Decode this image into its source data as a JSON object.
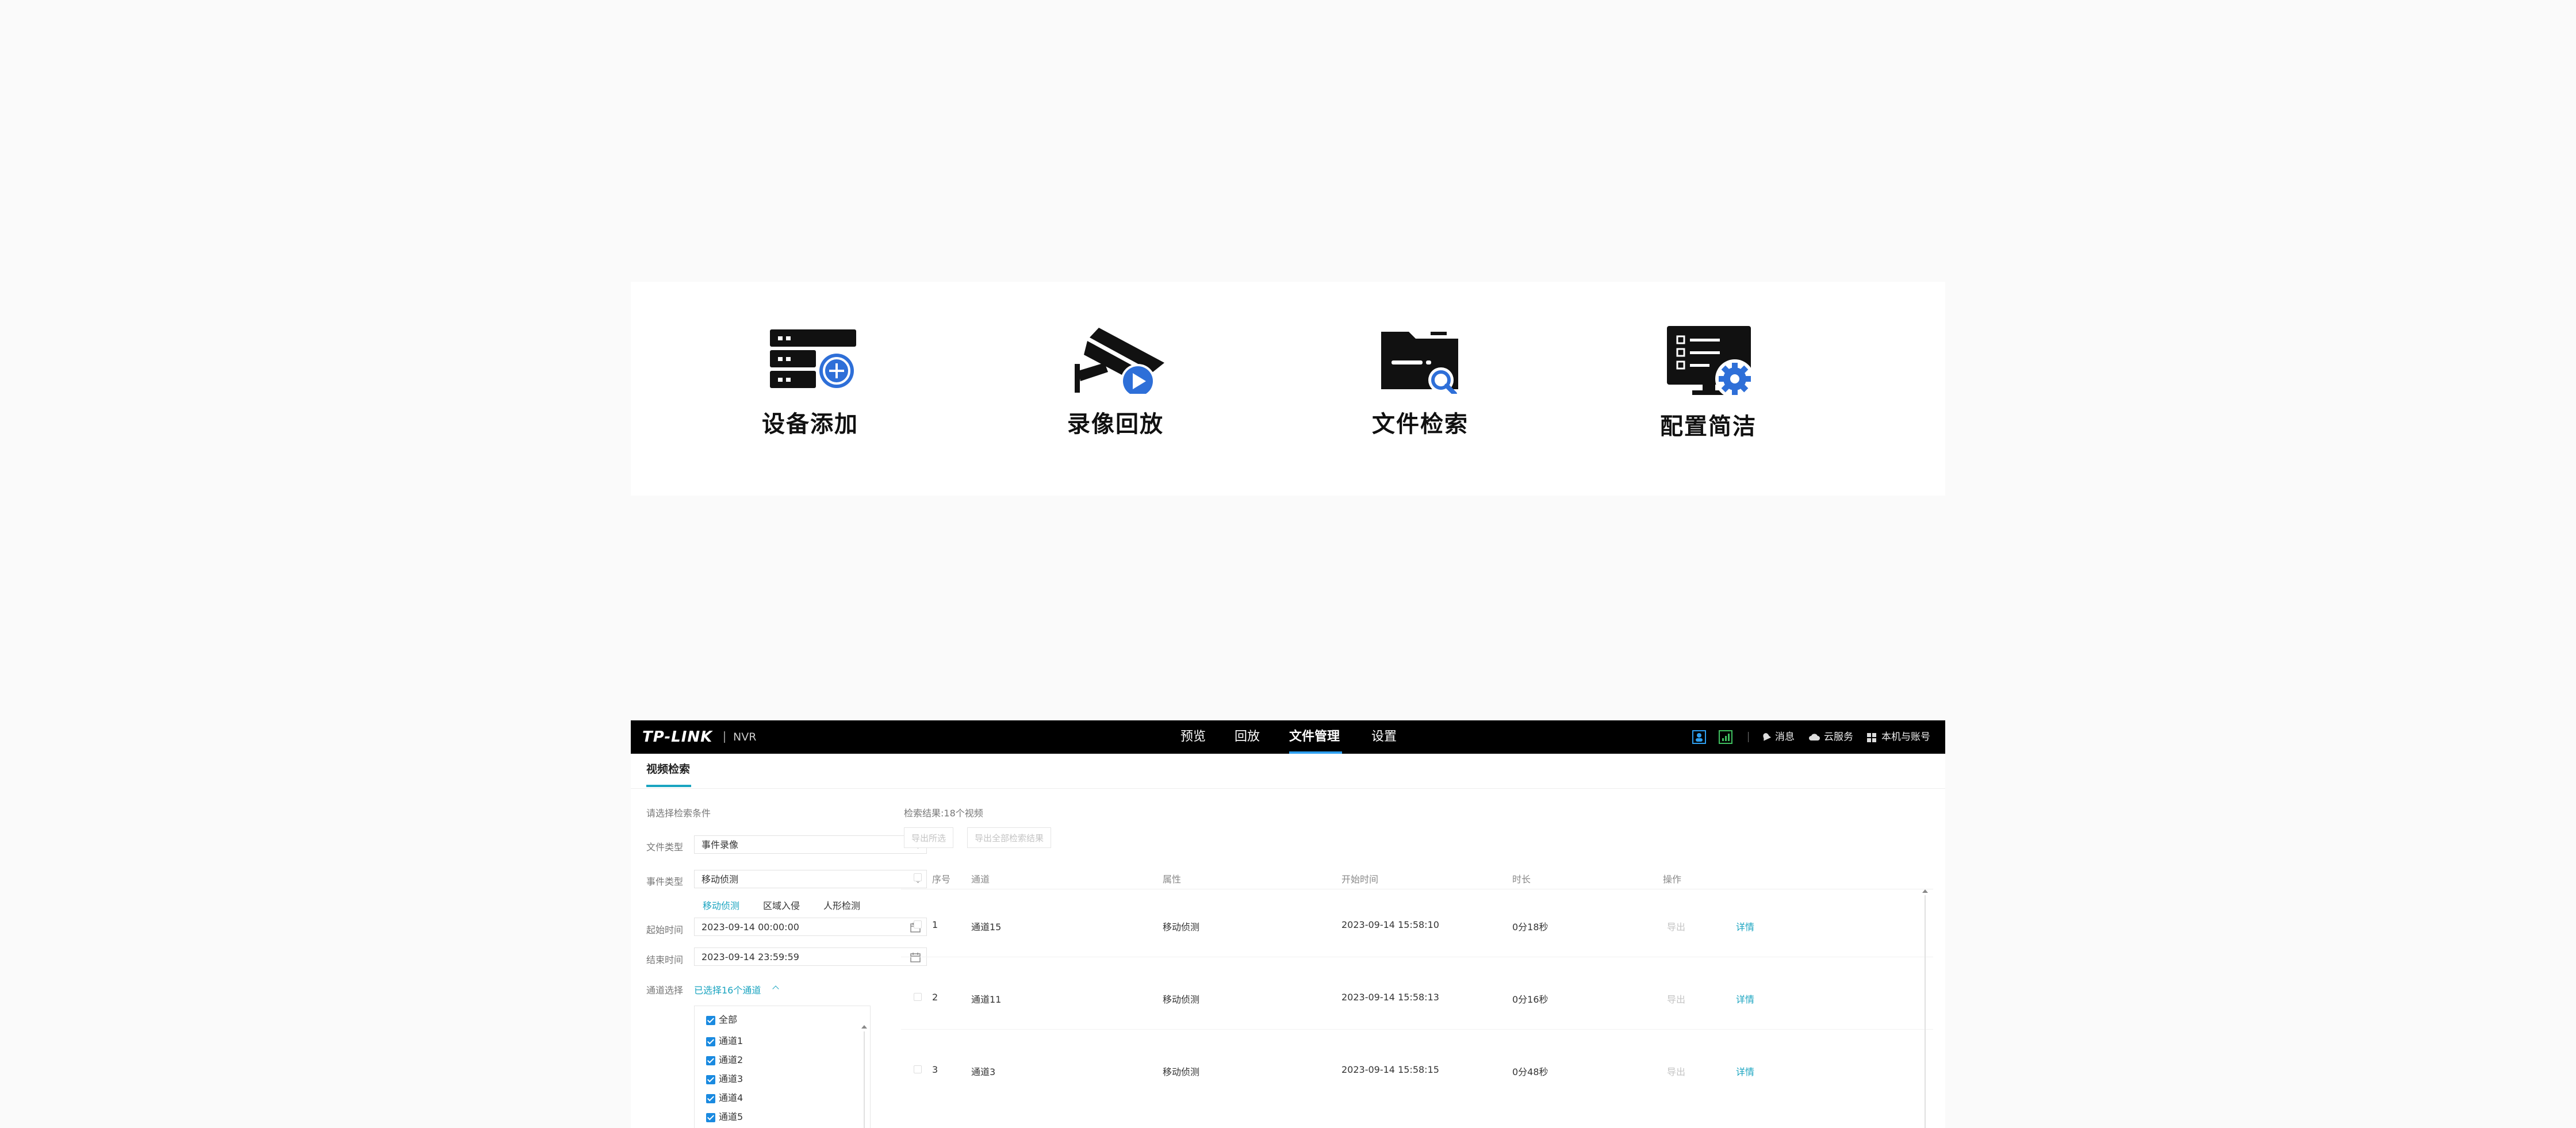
{
  "features": [
    {
      "label": "设备添加",
      "icon": "server-add-icon"
    },
    {
      "label": "录像回放",
      "icon": "camera-playback-icon"
    },
    {
      "label": "文件检索",
      "icon": "folder-search-icon"
    },
    {
      "label": "配置简洁",
      "icon": "monitor-settings-icon"
    }
  ],
  "nvr": {
    "brand": "TP-LINK",
    "product": "NVR",
    "nav": [
      "预览",
      "回放",
      "文件管理",
      "设置"
    ],
    "nav_active": "文件管理",
    "top_right": {
      "messages": "消息",
      "cloud": "云服务",
      "account": "本机与账号"
    },
    "subtab": "视频检索",
    "form": {
      "heading": "请选择检索条件",
      "file_type_label": "文件类型",
      "file_type_value": "事件录像",
      "event_type_label": "事件类型",
      "event_type_value": "移动侦测",
      "event_options": [
        "移动侦测",
        "区域入侵",
        "人形检测"
      ],
      "start_label": "起始时间",
      "start_value": "2023-09-14 00:00:00",
      "end_label": "结束时间",
      "end_value": "2023-09-14 23:59:59",
      "channel_label": "通道选择",
      "channel_value": "已选择16个通道",
      "channels": [
        "全部",
        "通道1",
        "通道2",
        "通道3",
        "通道4",
        "通道5"
      ]
    },
    "results": {
      "summary": "检索结果:18个视频",
      "export_selected": "导出所选",
      "export_all": "导出全部检索结果",
      "columns": [
        "序号",
        "通道",
        "属性",
        "开始时间",
        "时长",
        "操作"
      ],
      "rows": [
        {
          "index": "1",
          "channel": "通道15",
          "attr": "移动侦测",
          "start": "2023-09-14 15:58:10",
          "duration": "0分18秒",
          "export": "导出",
          "detail": "详情"
        },
        {
          "index": "2",
          "channel": "通道11",
          "attr": "移动侦测",
          "start": "2023-09-14 15:58:13",
          "duration": "0分16秒",
          "export": "导出",
          "detail": "详情"
        },
        {
          "index": "3",
          "channel": "通道3",
          "attr": "移动侦测",
          "start": "2023-09-14 15:58:15",
          "duration": "0分48秒",
          "export": "导出",
          "detail": "详情"
        }
      ]
    }
  },
  "colors": {
    "accent": "#1aa4c0",
    "blue": "#2e6fd8",
    "topbar": "#000000"
  }
}
